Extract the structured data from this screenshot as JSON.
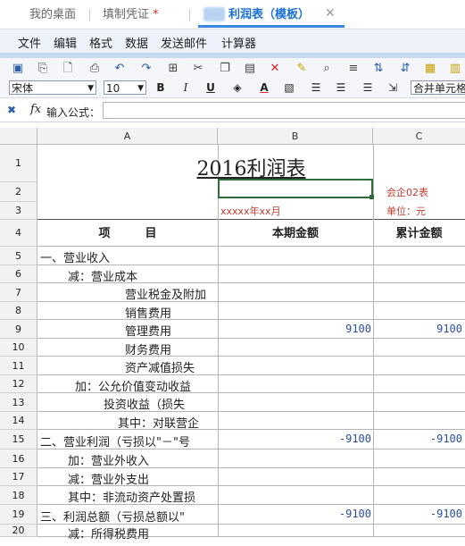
{
  "tabs": [
    {
      "label": "我的桌面"
    },
    {
      "label": "填制凭证",
      "star": "*"
    },
    {
      "label": "利润表（模板）"
    }
  ],
  "tab_close": "✕",
  "menu": [
    "文件",
    "编辑",
    "格式",
    "数据",
    "发送邮件",
    "计算器"
  ],
  "toolbar": {
    "font": "宋体",
    "size": "10",
    "bold": "B",
    "italic": "I",
    "underline": "U",
    "font_color": "A",
    "merge": "合并单元格"
  },
  "formula": {
    "fx": "fx",
    "label": "输入公式："
  },
  "columns": [
    "A",
    "B",
    "C"
  ],
  "rows": [
    {
      "n": "1"
    },
    {
      "n": "2"
    },
    {
      "n": "3"
    },
    {
      "n": "4"
    },
    {
      "n": "5"
    },
    {
      "n": "6"
    },
    {
      "n": "7"
    },
    {
      "n": "8"
    },
    {
      "n": "9"
    },
    {
      "n": "10"
    },
    {
      "n": "11"
    },
    {
      "n": "12"
    },
    {
      "n": "13"
    },
    {
      "n": "14"
    },
    {
      "n": "15"
    },
    {
      "n": "16"
    },
    {
      "n": "17"
    },
    {
      "n": "18"
    },
    {
      "n": "19"
    },
    {
      "n": "20"
    }
  ],
  "sheet": {
    "title": "2016利润表",
    "form_code": "会企02表",
    "period": "xxxxx年xx月",
    "unit": "单位：元",
    "hdr_item": "项　　　目",
    "hdr_current": "本期金额",
    "hdr_cumulative": "累计金额",
    "items": [
      {
        "label": "一、营业收入",
        "b": "",
        "c": ""
      },
      {
        "label": "减：营业成本",
        "b": "",
        "c": ""
      },
      {
        "label": "营业税金及附加",
        "b": "",
        "c": ""
      },
      {
        "label": "销售费用",
        "b": "",
        "c": ""
      },
      {
        "label": "管理费用",
        "b": "9100",
        "c": "9100"
      },
      {
        "label": "财务费用",
        "b": "",
        "c": ""
      },
      {
        "label": "资产减值损失",
        "b": "",
        "c": ""
      },
      {
        "label": "加：公允价值变动收益",
        "b": "",
        "c": ""
      },
      {
        "label": "投资收益（损失",
        "b": "",
        "c": ""
      },
      {
        "label": "其中：对联营企",
        "b": "",
        "c": ""
      },
      {
        "label": "二、营业利润（亏损以\"－\"号",
        "b": "-9100",
        "c": "-9100"
      },
      {
        "label": "加：营业外收入",
        "b": "",
        "c": ""
      },
      {
        "label": "减：营业外支出",
        "b": "",
        "c": ""
      },
      {
        "label": "其中：非流动资产处置损",
        "b": "",
        "c": ""
      },
      {
        "label": "三、利润总额（亏损总额以\"",
        "b": "-9100",
        "c": "-9100"
      },
      {
        "label": "减：所得税费用",
        "b": "",
        "c": ""
      }
    ]
  }
}
